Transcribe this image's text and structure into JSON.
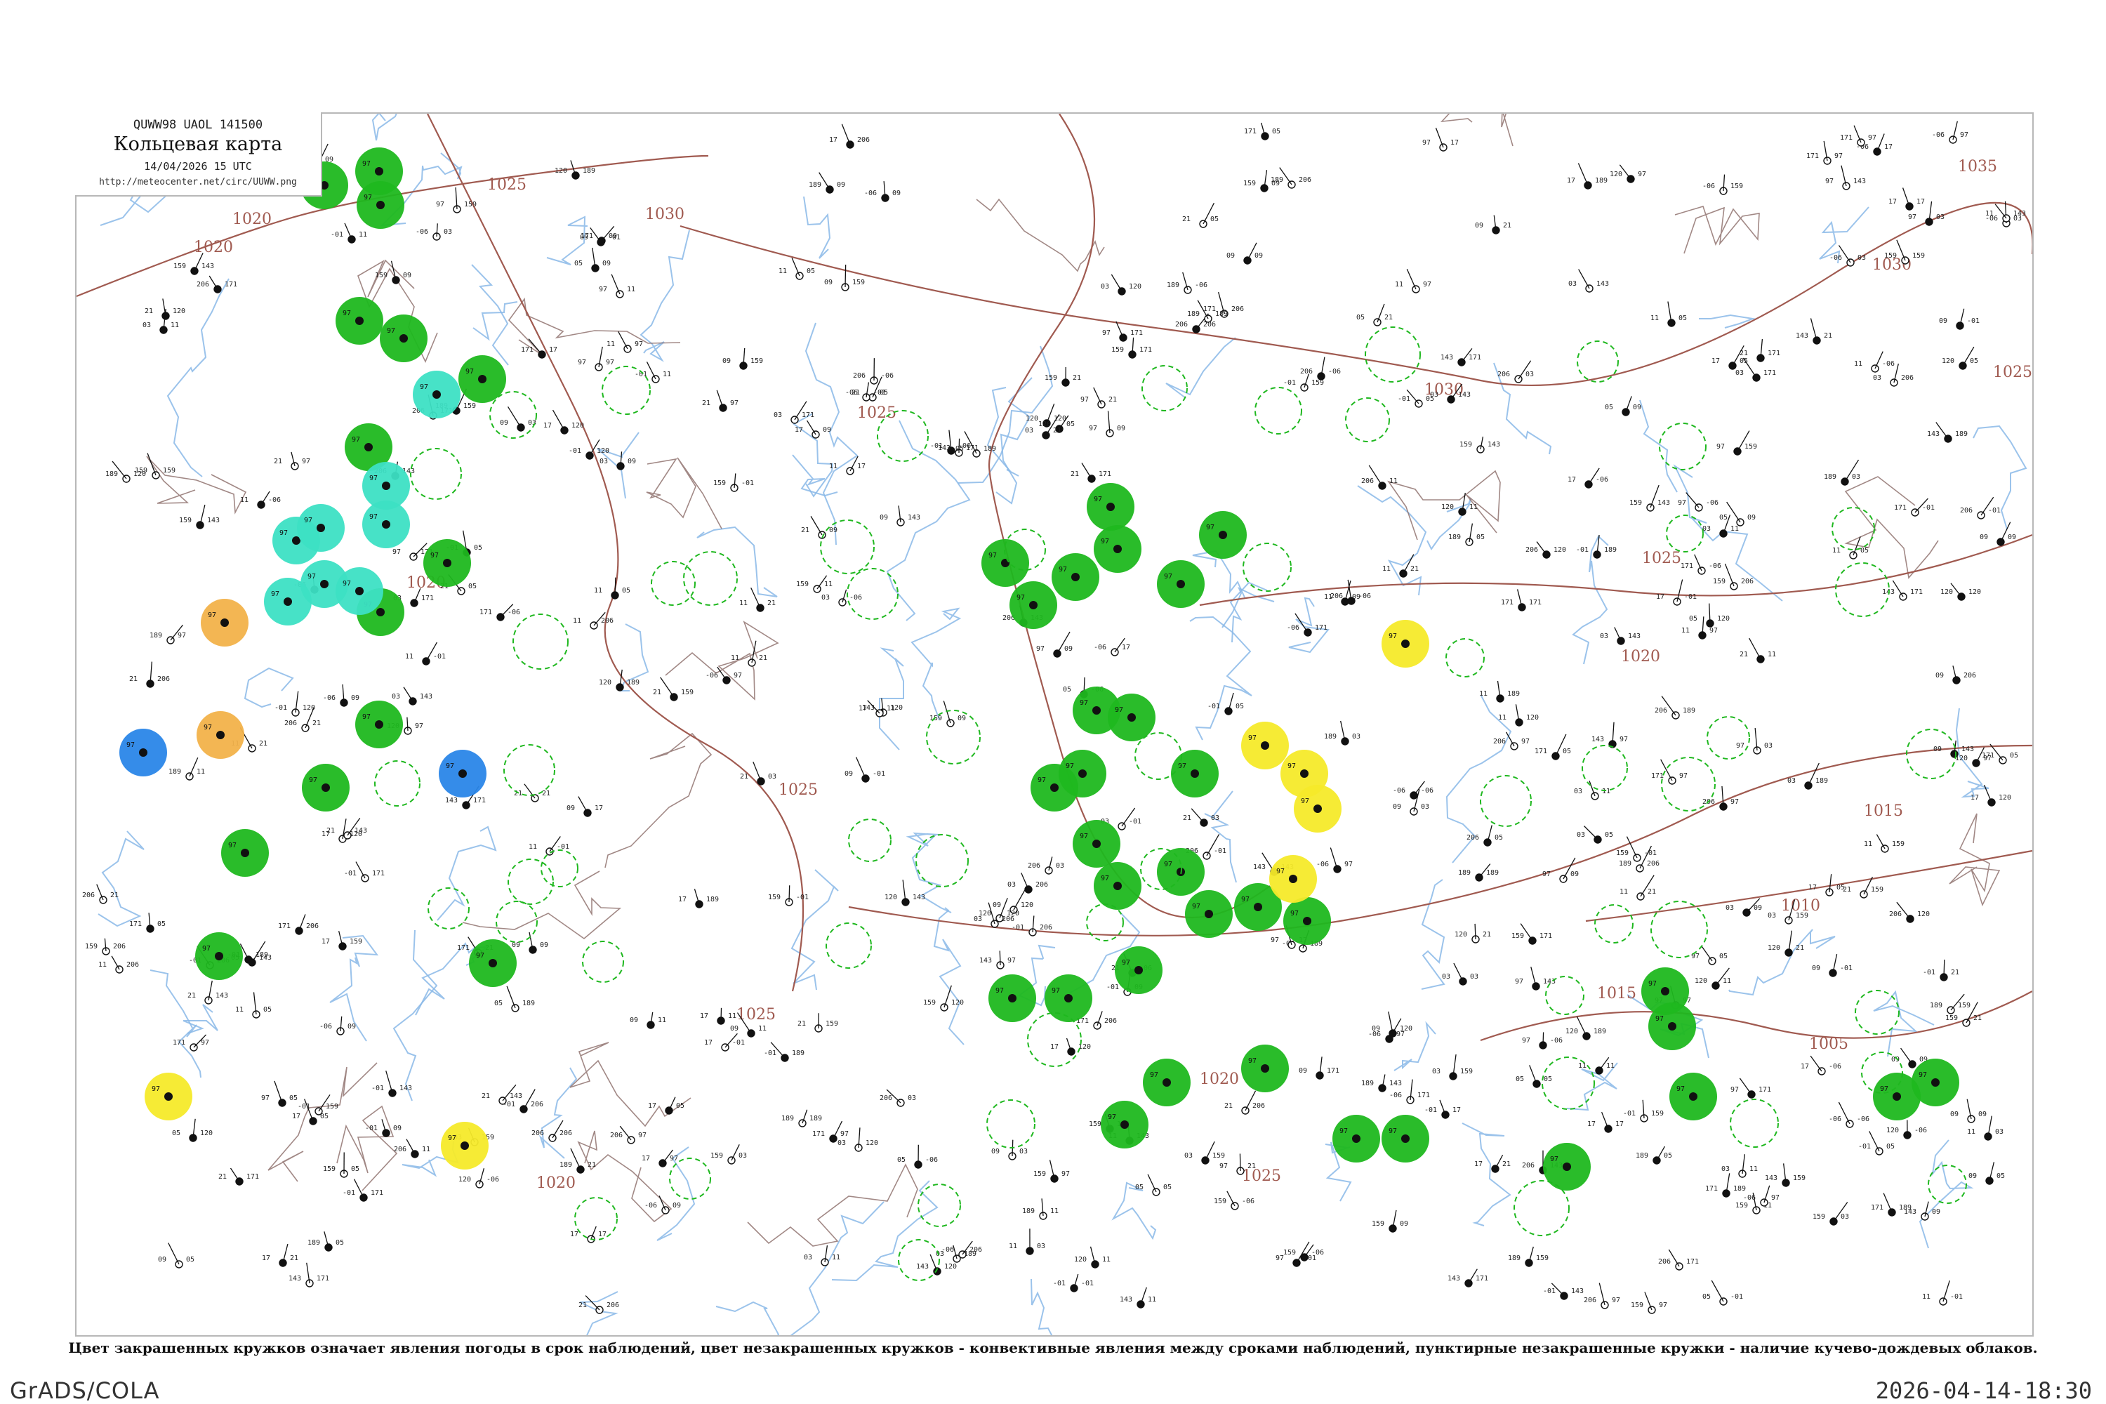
{
  "header": {
    "code": "QUWW98  UAOL  141500",
    "title": "Кольцевая карта",
    "datetime": "14/04/2026 15 UTC",
    "url": "http://meteocenter.net/circ/UUWW.png"
  },
  "isobars": {
    "color": "#a05a50",
    "labels": [
      "1020",
      "1025",
      "1030",
      "1035",
      "1015",
      "1010",
      "1005"
    ]
  },
  "colors": {
    "precip_circle": "#1fb81f",
    "snow_circle": "#3de0c4",
    "fog_circle": "#f5ea2a",
    "haze_circle": "#f2b24a",
    "rain_blue_circle": "#2a86e8",
    "river": "#8ab8e8",
    "boundary": "#8a6a66"
  },
  "markers": [
    {
      "name": "precip-station",
      "color": "#1fb81f"
    },
    {
      "name": "snow-station",
      "color": "#3de0c4"
    },
    {
      "name": "fog-station",
      "color": "#f5ea2a"
    },
    {
      "name": "haze-station",
      "color": "#f2b24a"
    },
    {
      "name": "blue-precip-station",
      "color": "#2a86e8"
    },
    {
      "name": "convective-ring",
      "color": "#1fb81f"
    }
  ],
  "caption": "Цвет закрашенных кружков означает явления погоды в срок наблюдений, цвет незакрашенных кружков - конвективные явления между сроками наблюдений, пунктирные незакрашенные кружки - наличие кучево-дождевых облаков.",
  "footer": {
    "left": "GrADS/COLA",
    "right": "2026-04-14-18:30"
  }
}
